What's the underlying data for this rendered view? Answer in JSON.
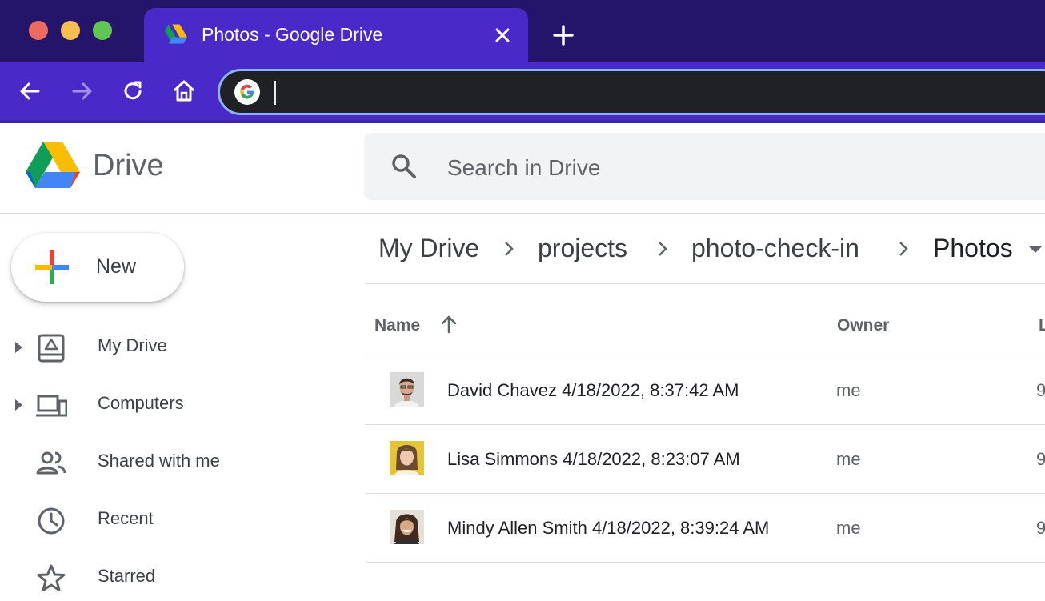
{
  "browser": {
    "tab_title": "Photos - Google Drive",
    "address_value": "",
    "colors": {
      "titlebar": "#24146a",
      "tab": "#4a29c9",
      "toolbar": "#4a29c9",
      "omnibox": "#202124",
      "omnibox_border": "#8ab4f8"
    }
  },
  "app": {
    "name": "Drive",
    "search": {
      "placeholder": "Search in Drive",
      "value": ""
    },
    "new_button": "New"
  },
  "sidebar": {
    "items": [
      {
        "label": "My Drive",
        "icon": "my-drive-icon",
        "expandable": true
      },
      {
        "label": "Computers",
        "icon": "computers-icon",
        "expandable": true
      },
      {
        "label": "Shared with me",
        "icon": "people-icon",
        "expandable": false
      },
      {
        "label": "Recent",
        "icon": "clock-icon",
        "expandable": false
      },
      {
        "label": "Starred",
        "icon": "star-icon",
        "expandable": false
      }
    ]
  },
  "breadcrumb": [
    "My Drive",
    "projects",
    "photo-check-in",
    "Photos"
  ],
  "table": {
    "columns": {
      "name": "Name",
      "owner": "Owner",
      "modified": "L"
    },
    "sort": "ascending",
    "rows": [
      {
        "name": "David Chavez 4/18/2022, 8:37:42 AM",
        "owner": "me",
        "modified": "9",
        "thumb_bg": "#d9d9d9",
        "thumb_hair": "#3b2a20"
      },
      {
        "name": "Lisa Simmons 4/18/2022, 8:23:07 AM",
        "owner": "me",
        "modified": "9",
        "thumb_bg": "#e3c43b",
        "thumb_hair": "#6b4a2e"
      },
      {
        "name": "Mindy Allen Smith 4/18/2022, 8:39:24 AM",
        "owner": "me",
        "modified": "9",
        "thumb_bg": "#e6e1d8",
        "thumb_hair": "#3e2a1e"
      }
    ]
  }
}
